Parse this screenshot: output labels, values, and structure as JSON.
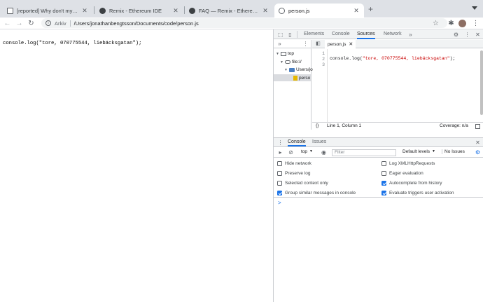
{
  "tabs": [
    {
      "label": "[reported] Why don't my console.log",
      "active": false
    },
    {
      "label": "Remix - Ethereum IDE",
      "active": false
    },
    {
      "label": "FAQ — Remix - Ethereum IDE 1",
      "active": false
    },
    {
      "label": "person.js",
      "active": true
    }
  ],
  "toolbar": {
    "origin_label": "Arkiv",
    "url": "/Users/jonathanbengtsson/Documents/code/person.js"
  },
  "page": {
    "content": "console.log(\"tore, 070775544, liebäcksgatan\");"
  },
  "devtools": {
    "tabs": [
      "Elements",
      "Console",
      "Sources",
      "Network"
    ],
    "selected_tab": "Sources",
    "navigator": {
      "items": [
        {
          "label": "top",
          "icon": "frame-icon"
        },
        {
          "label": "file://",
          "icon": "cloud-icon"
        },
        {
          "label": "Users/jo",
          "icon": "folder-icon"
        },
        {
          "label": "perso",
          "icon": "file-icon"
        }
      ]
    },
    "editor": {
      "file_tab": "person.js",
      "line_numbers": [
        "1",
        "2",
        "3"
      ],
      "code_prefix": "console.log(",
      "code_string": "\"tore, 070775544, liebäcksgatan\"",
      "code_suffix": ");",
      "status_position": "Line 1, Column 1",
      "status_coverage": "Coverage: n/a",
      "braces": "{}"
    },
    "drawer": {
      "tabs": [
        "Console",
        "Issues"
      ],
      "selected_tab": "Console",
      "context": "top",
      "filter_placeholder": "Filter",
      "levels": "Default levels",
      "issues": "No Issues",
      "settings_left": [
        {
          "label": "Hide network",
          "checked": false
        },
        {
          "label": "Preserve log",
          "checked": false
        },
        {
          "label": "Selected context only",
          "checked": false
        },
        {
          "label": "Group similar messages in console",
          "checked": true
        }
      ],
      "settings_right": [
        {
          "label": "Log XMLHttpRequests",
          "checked": false
        },
        {
          "label": "Eager evaluation",
          "checked": false
        },
        {
          "label": "Autocomplete from history",
          "checked": true
        },
        {
          "label": "Evaluate triggers user activation",
          "checked": true
        }
      ],
      "prompt": ">"
    }
  },
  "colors": {
    "accent": "#1a73e8",
    "string": "#c80000"
  }
}
